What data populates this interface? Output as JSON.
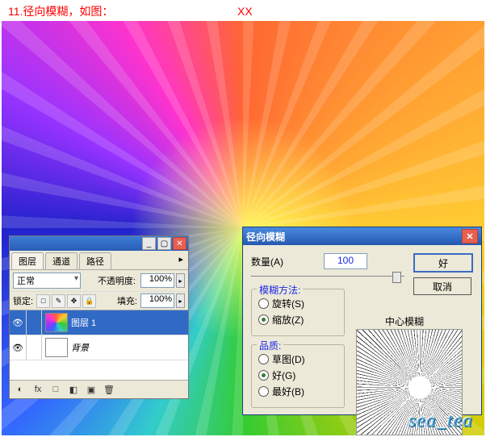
{
  "top_caption": "11.径向模糊，如图：",
  "top_xx": "XX",
  "layers_panel": {
    "tabs": {
      "layers": "图层",
      "channels": "通道",
      "paths": "路径"
    },
    "mode": "正常",
    "opacity_label": "不透明度:",
    "opacity_value": "100%",
    "lock_label": "锁定:",
    "fill_label": "填充:",
    "fill_value": "100%",
    "rows": [
      {
        "name": "图层 1"
      },
      {
        "name": "背景"
      }
    ],
    "lock_icons": [
      "□",
      "✎",
      "✥",
      "🔒"
    ],
    "bottom_icons": [
      "◐",
      "fx",
      "□",
      "◧",
      "▣",
      "🗑"
    ]
  },
  "dialog": {
    "title": "径向模糊",
    "amount_label": "数量(A)",
    "amount_value": "100",
    "ok": "好",
    "cancel": "取消",
    "method_legend": "模糊方法:",
    "method_spin": "旋转(S)",
    "method_zoom": "缩放(Z)",
    "quality_legend": "品质:",
    "q_draft": "草图(D)",
    "q_good": "好(G)",
    "q_best": "最好(B)",
    "preview_label": "中心模糊"
  },
  "watermark": "sea_tea"
}
